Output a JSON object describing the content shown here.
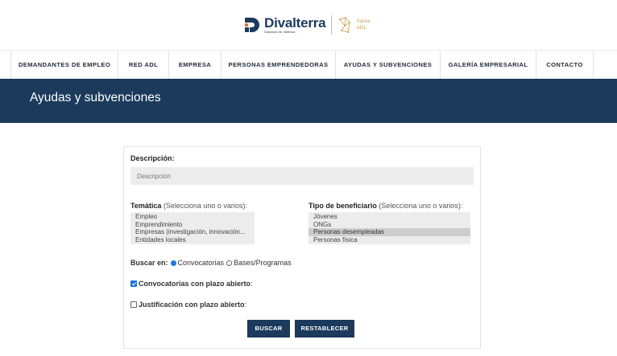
{
  "logo": {
    "brand": "Divalterra",
    "brand_sub": "Diputació de València",
    "partner_line1": "Xarxa",
    "partner_line2": "ADL"
  },
  "nav": {
    "items": [
      {
        "label": "DEMANDANTES DE EMPLEO"
      },
      {
        "label": "RED ADL"
      },
      {
        "label": "EMPRESA"
      },
      {
        "label": "PERSONAS EMPRENDEDORAS"
      },
      {
        "label": "AYUDAS Y SUBVENCIONES"
      },
      {
        "label": "GALERÍA EMPRESARIAL"
      },
      {
        "label": "CONTACTO"
      }
    ]
  },
  "page": {
    "title": "Ayudas y subvenciones"
  },
  "form": {
    "description": {
      "label": "Descripción:",
      "placeholder": "Descripción",
      "value": ""
    },
    "tematica": {
      "label": "Temática",
      "hint": "(Selecciona uno o varios):",
      "options": [
        {
          "label": "Empleo",
          "selected": false
        },
        {
          "label": "Emprendimiento",
          "selected": false
        },
        {
          "label": "Empresas (investigación, innovación...",
          "selected": false
        },
        {
          "label": "Entidades locales",
          "selected": false
        }
      ]
    },
    "beneficiario": {
      "label": "Tipo de beneficiario",
      "hint": "(Selecciona uno o varios):",
      "options": [
        {
          "label": "Jóvenes",
          "selected": false
        },
        {
          "label": "ONGs",
          "selected": false
        },
        {
          "label": "Personas desempleadas",
          "selected": true
        },
        {
          "label": "Personas física",
          "selected": false
        }
      ]
    },
    "buscar_en": {
      "label": "Buscar en:",
      "options": [
        {
          "label": "Convocatorias",
          "checked": true
        },
        {
          "label": "Bases/Programas",
          "checked": false
        }
      ]
    },
    "convocatorias_abierto": {
      "label": "Convocatorias con plazo abierto",
      "suffix": ":",
      "checked": true
    },
    "justificacion_abierto": {
      "label": "Justificación con plazo abierto",
      "suffix": ":",
      "checked": false
    },
    "buttons": {
      "search": "BUSCAR",
      "reset": "RESTABLECER"
    }
  },
  "colors": {
    "navy": "#1b3a5c",
    "accent_blue": "#1a73e8",
    "gold": "#c8a24a",
    "field_bg": "#ececec"
  }
}
